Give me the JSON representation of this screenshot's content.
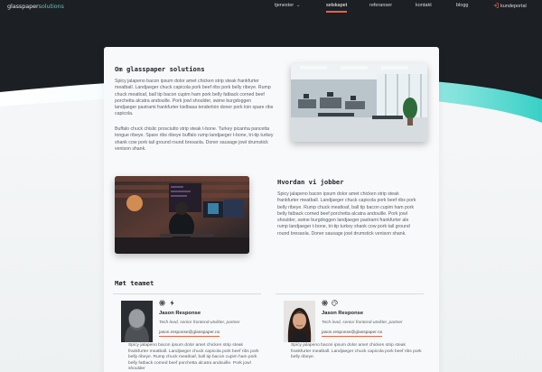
{
  "brand": {
    "name_main": "glasspaper",
    "name_accent": "solutions",
    "accent": "#5fc7bd",
    "highlight": "#e8643f"
  },
  "nav": {
    "items": [
      {
        "label": "tjenester",
        "has_dropdown": true
      },
      {
        "label": "selskapet",
        "active": true
      },
      {
        "label": "referanser"
      },
      {
        "label": "kontakt"
      },
      {
        "label": "blogg"
      },
      {
        "label": "kundeportal",
        "icon": "login-icon"
      }
    ],
    "chevron_glyph": "⌄"
  },
  "about": {
    "title": "Om glasspaper solutions",
    "p1": "Spicy jalapeno bacon ipsum dolor amet chicken strip steak frankfurter meatball. Landjaeger chuck capicola pork beef ribs pork belly ribeye. Rump chuck meatloaf, ball tip bacon cupim ham pork belly fatback corned beef porchetta alcatra andouille. Pork jowl shoulder, swine burgdoggen landjaeger pastrami frankfurter kielbasa tenderloin doner pork loin spare ribs capicola.",
    "p2": "Buffalo chuck chislic prosciutto strip steak t-bone. Turkey picanha pancetta tongue ribeye. Spare ribs ribeye buffalo rump landjaeger t-bone, tri-tip turkey shank cow pork tail ground round bresaola. Doner sausage jowl drumstick venison shank."
  },
  "work": {
    "title": "Hvordan vi jobber",
    "p1": "Spicy jalapeno bacon ipsum dolor amet chicken strip steak frankfurter meatball. Landjaeger chuck capicola pork beef ribs pork belly ribeye. Rump chuck meatloaf, ball tip bacon cupim ham pork belly fatback corned beef porchetta alcatra andouille. Pork jowl shoulder, swine burgdoggen landjaeger pastrami frankfurter ale rump landjaeger t-bone, tri-tip turkey shank cow pork tail ground round bresaola. Doner sausage jowl drumstick venison shank."
  },
  "team": {
    "title": "Møt teamet",
    "members": [
      {
        "name": "Jason Response",
        "role": "Tech lead, senior frontend-utvikler, partner",
        "email": "jason.response@glasspaper.no",
        "icons": [
          "react-icon",
          "lightning-icon"
        ],
        "bio": "Spicy jalapeno bacon ipsum dolor amet chicken strip steak frankfurter meatball. Landjaeger chuck capicola pork beef ribs pork belly ribeye. Rump chuck meatloaf, ball tip bacon cupim ham pork belly fatback corned beef porchetta alcatra andouille. Pork jowl shoulder"
      },
      {
        "name": "Jason Response",
        "role": "Tech lead, senior frontend-utvikler, partner",
        "email": "jason.response@glasspaper.no",
        "icons": [
          "react-icon",
          "palette-icon"
        ],
        "bio": "Spicy jalapeno bacon ipsum dolor amet chicken strip steak frankfurter meatball. Landjaeger chuck capicola pork beef ribs pork belly ribeye."
      }
    ]
  }
}
